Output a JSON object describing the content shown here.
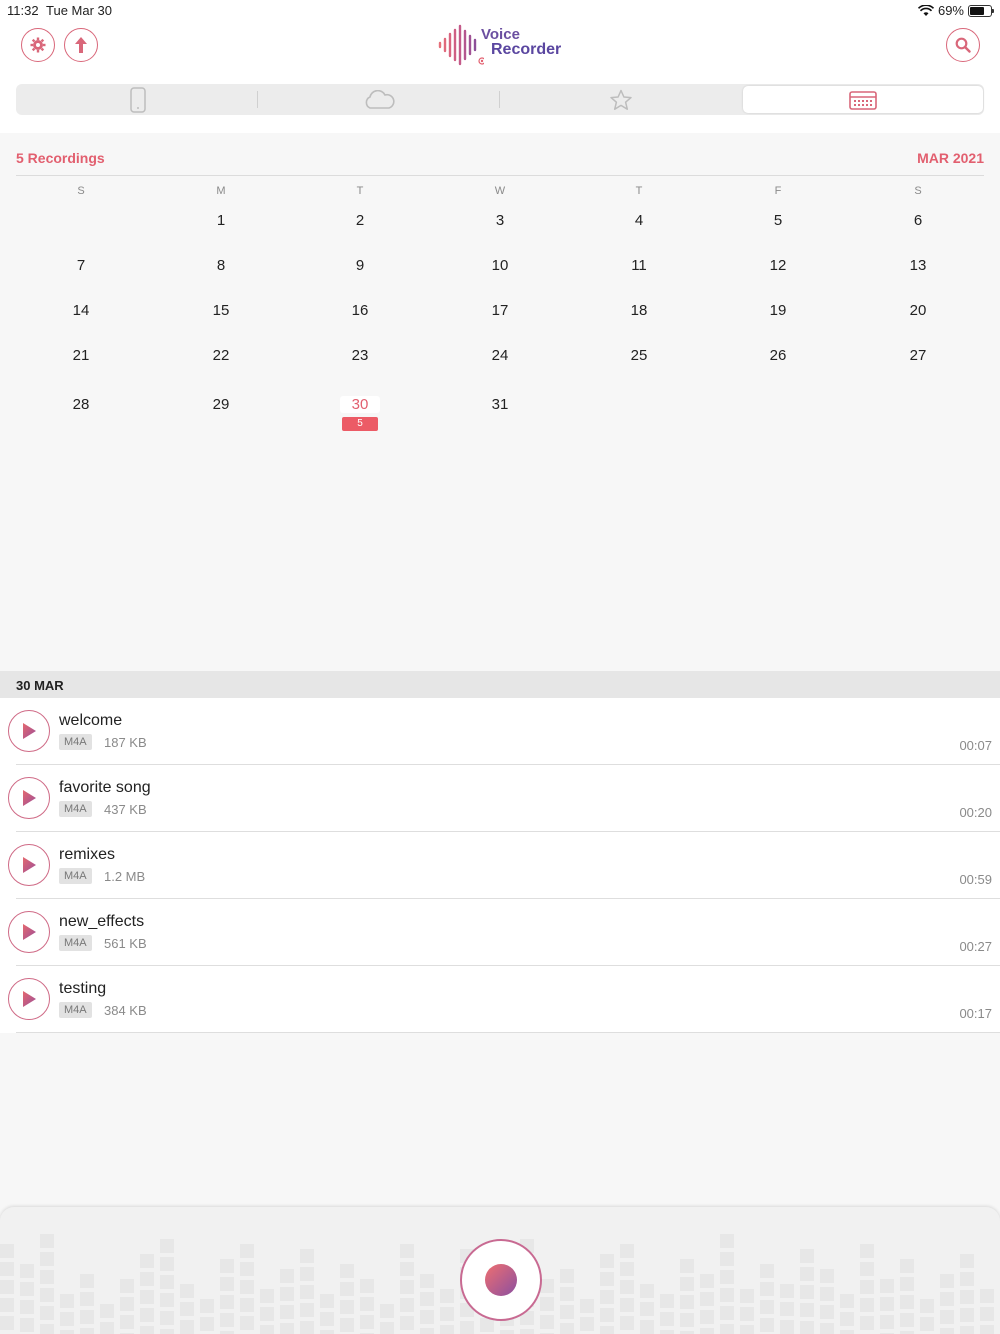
{
  "status": {
    "time": "11:32",
    "date": "Tue Mar 30",
    "battery": "69%"
  },
  "app": {
    "logo_line1": "Voice",
    "logo_line2": "Recorder"
  },
  "header": {
    "settings_icon": "gear-icon",
    "upload_icon": "upload-arrow-icon",
    "search_icon": "search-icon"
  },
  "tabs": [
    {
      "icon": "phone-icon",
      "selected": false
    },
    {
      "icon": "cloud-icon",
      "selected": false
    },
    {
      "icon": "star-icon",
      "selected": false
    },
    {
      "icon": "calendar-icon",
      "selected": true
    }
  ],
  "calendar": {
    "recordings_count": "5 Recordings",
    "month_label": "MAR 2021",
    "weekdays": [
      "S",
      "M",
      "T",
      "W",
      "T",
      "F",
      "S"
    ],
    "weeks": [
      [
        "",
        "1",
        "2",
        "3",
        "4",
        "5",
        "6"
      ],
      [
        "7",
        "8",
        "9",
        "10",
        "11",
        "12",
        "13"
      ],
      [
        "14",
        "15",
        "16",
        "17",
        "18",
        "19",
        "20"
      ],
      [
        "21",
        "22",
        "23",
        "24",
        "25",
        "26",
        "27"
      ],
      [
        "28",
        "29",
        "30",
        "31",
        "",
        "",
        ""
      ]
    ],
    "today": "30",
    "today_badge": "5"
  },
  "list": {
    "section_title": "30 MAR",
    "recordings": [
      {
        "name": "welcome",
        "format": "M4A",
        "size": "187 KB",
        "duration": "00:07"
      },
      {
        "name": "favorite song",
        "format": "M4A",
        "size": "437 KB",
        "duration": "00:20"
      },
      {
        "name": "remixes",
        "format": "M4A",
        "size": "1.2 MB",
        "duration": "00:59"
      },
      {
        "name": "new_effects",
        "format": "M4A",
        "size": "561 KB",
        "duration": "00:27"
      },
      {
        "name": "testing",
        "format": "M4A",
        "size": "384 KB",
        "duration": "00:17"
      }
    ]
  },
  "colors": {
    "accent": "#e25f6f",
    "brand_purple": "#6b4fa0",
    "badge": "#ec5b66"
  }
}
